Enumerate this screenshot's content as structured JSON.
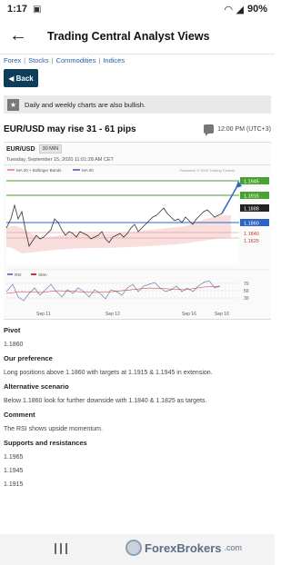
{
  "status": {
    "time": "1:17",
    "battery": "90%"
  },
  "header": {
    "title": "Trading Central Analyst Views"
  },
  "breadcrumb": [
    "Forex",
    "Stocks",
    "Commodities",
    "Indices"
  ],
  "back_button": "Back",
  "info_note": "Daily and weekly charts are also bullish.",
  "headline": "EUR/USD may rise 31 - 61 pips",
  "time_text": "12:00 PM (UTC+3)",
  "chart": {
    "pair": "EUR/USD",
    "timeframe": "30 MIN",
    "date": "Tuesday, September 15, 2020 11:01:28 AM CET",
    "legend_main": [
      "MA 20 + Bollinger Bands",
      "MA 50"
    ],
    "copyright": "Research © 2020 Trading Central",
    "indicator_legend": [
      "RSI",
      "SMA"
    ],
    "x_labels": [
      "Sep 11",
      "Sep 12",
      "Sep 16",
      "Sep 16"
    ],
    "price_levels": [
      {
        "label": "1.1945",
        "color": "#4aa232"
      },
      {
        "label": "1.1915",
        "color": "#4aa232"
      },
      {
        "label": "1.1888",
        "color": "#222222"
      },
      {
        "label": "1.1860",
        "color": "#2e64c8"
      },
      {
        "label": "1.1840",
        "color": "#cc3333"
      },
      {
        "label": "1.1825",
        "color": "#cc3333"
      }
    ],
    "rsi_levels": [
      "70",
      "50",
      "30"
    ]
  },
  "sections": [
    {
      "label": "Pivot",
      "value": "1.1860"
    },
    {
      "label": "Our preference",
      "value": "Long positions above 1.1860 with targets at 1.1915 & 1.1945 in extension."
    },
    {
      "label": "Alternative scenario",
      "value": "Below 1.1860 look for further downside with 1.1840 & 1.1825 as targets."
    },
    {
      "label": "Comment",
      "value": "The RSI shows upside momentum."
    },
    {
      "label": "Supports and resistances",
      "value": "1.1965"
    }
  ],
  "sr_more": [
    "1.1945",
    "1.1915"
  ],
  "watermark": {
    "name": "ForexBrokers",
    "suffix": ".com"
  }
}
